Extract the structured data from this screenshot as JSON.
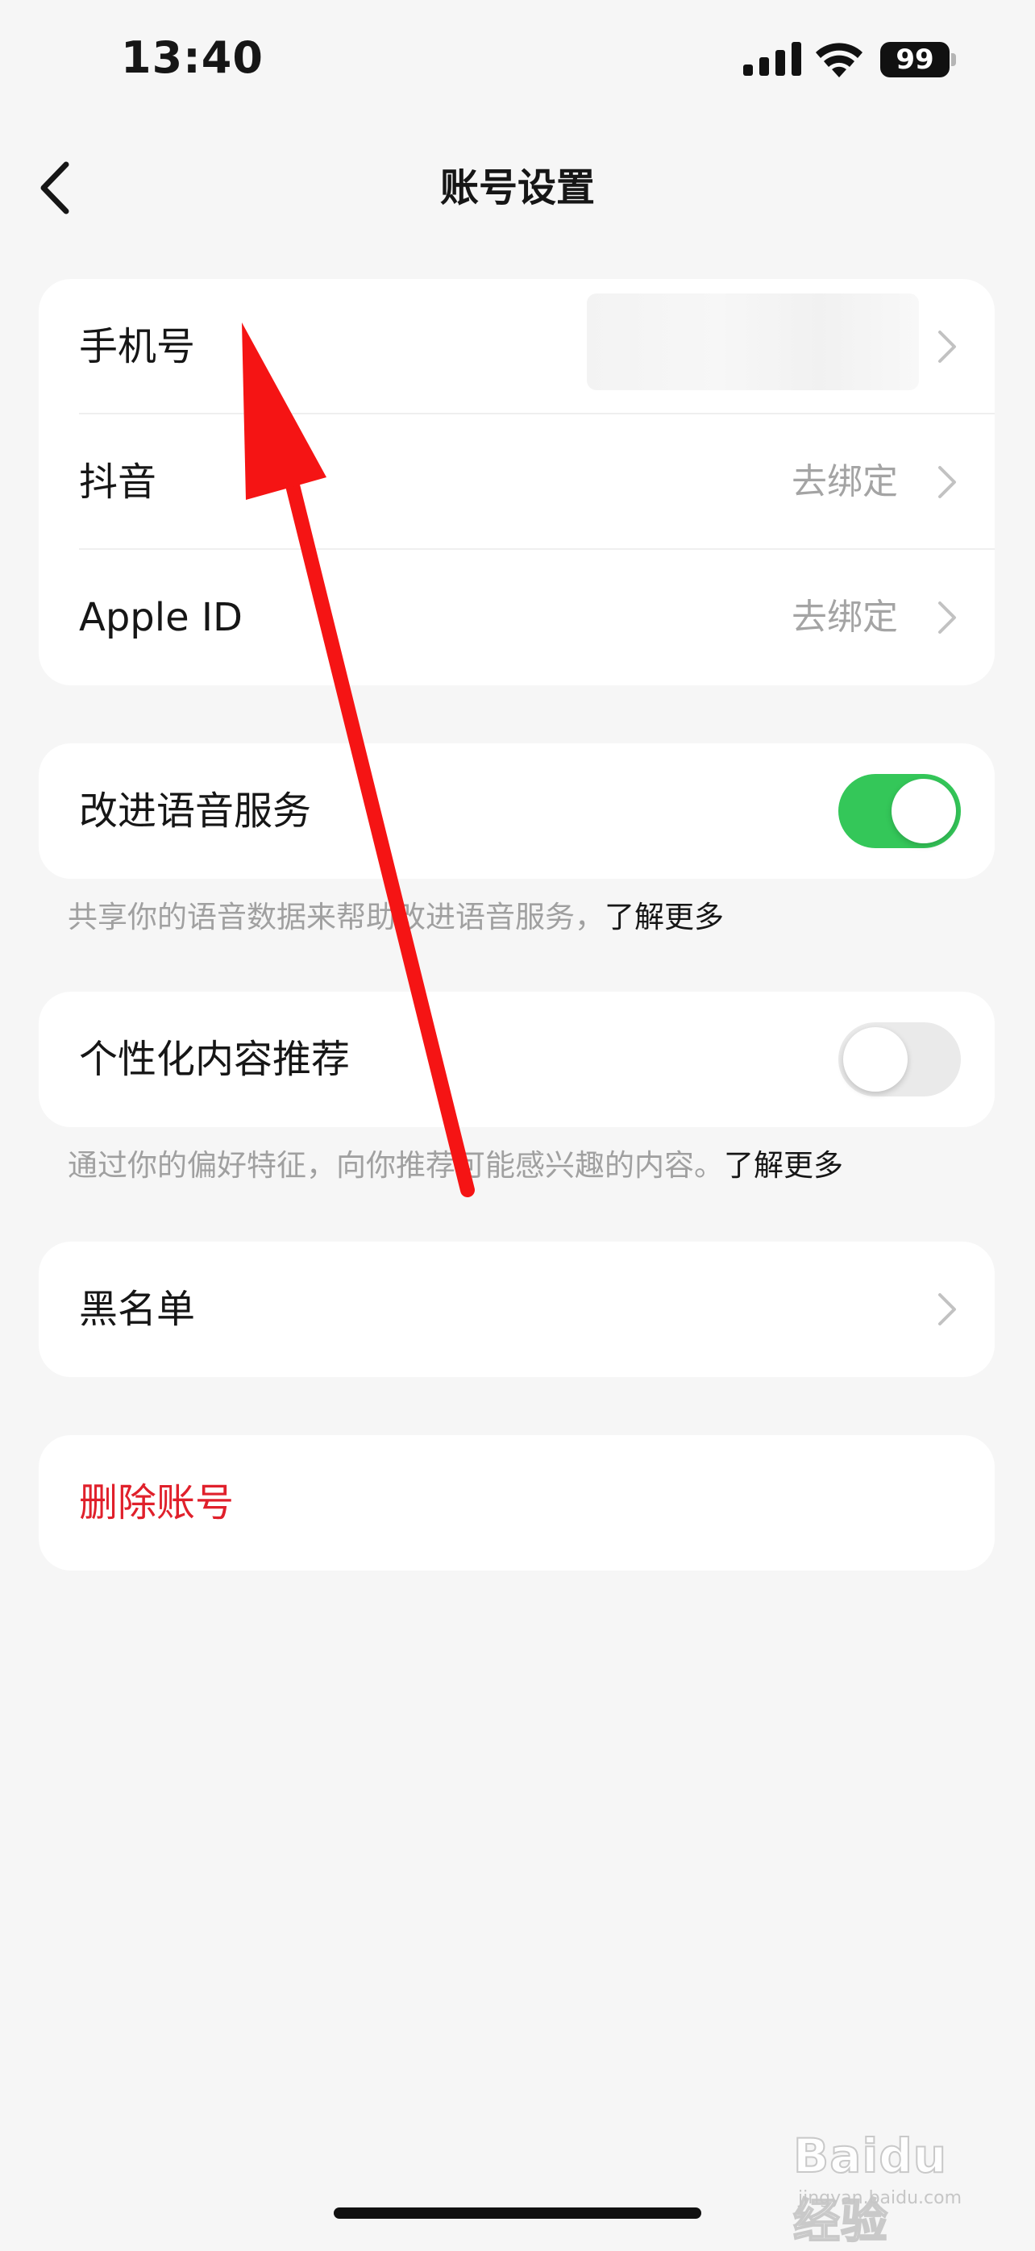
{
  "status_bar": {
    "time": "13:40",
    "battery": "99"
  },
  "nav": {
    "title": "账号设置"
  },
  "account_card": {
    "rows": [
      {
        "label": "手机号",
        "value": ""
      },
      {
        "label": "抖音",
        "value": "去绑定"
      },
      {
        "label": "Apple ID",
        "value": "去绑定"
      }
    ]
  },
  "voice_service": {
    "label": "改进语音服务",
    "enabled": true,
    "hint": "共享你的语音数据来帮助改进语音服务，",
    "hint_link": "了解更多"
  },
  "personalization": {
    "label": "个性化内容推荐",
    "enabled": false,
    "hint": "通过你的偏好特征，向你推荐可能感兴趣的内容。",
    "hint_link": "了解更多"
  },
  "blacklist": {
    "label": "黑名单"
  },
  "delete_account": {
    "label": "删除账号"
  },
  "watermark": {
    "brand": "Baidu经验",
    "url": "jingyan.baidu.com"
  },
  "colors": {
    "toggle_on": "#34c759",
    "danger": "#e0202b",
    "arrow": "#f51414"
  }
}
